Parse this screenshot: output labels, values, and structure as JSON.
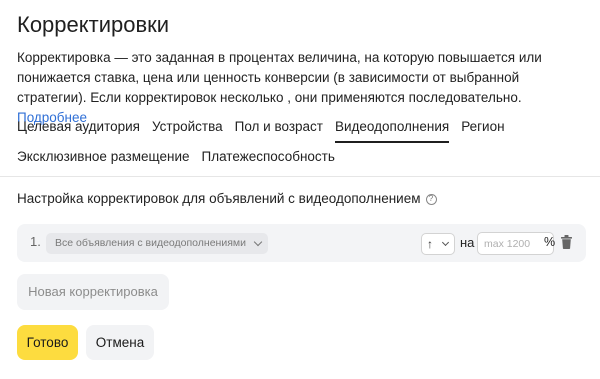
{
  "page": {
    "title": "Корректировки",
    "description": "Корректировка — это заданная в процентах величина, на которую повышается или понижается ставка, цена или ценность конверсии (в зависимости от выбранной стратегии). Если корректировок несколько , они применяются последовательно.",
    "more_link": "Подробнее"
  },
  "tabs": [
    {
      "label": "Целевая аудитория",
      "active": false
    },
    {
      "label": "Устройства",
      "active": false
    },
    {
      "label": "Пол и возраст",
      "active": false
    },
    {
      "label": "Видеодополнения",
      "active": true
    },
    {
      "label": "Регион",
      "active": false
    },
    {
      "label": "Эксклюзивное размещение",
      "active": false
    },
    {
      "label": "Платежеспособность",
      "active": false
    }
  ],
  "section": {
    "label": "Настройка корректировок для объявлений с видеодополнением",
    "help_icon": "help-icon"
  },
  "adjustment_row": {
    "number": "1.",
    "ad_filter": "Все объявления с видеодополнениями",
    "direction": "↑",
    "na_label": "на",
    "value": "",
    "value_placeholder": "max 1200",
    "unit": "%",
    "delete_icon": "trash-icon"
  },
  "buttons": {
    "new_adjustment": "Новая корректировка",
    "done": "Готово",
    "cancel": "Отмена"
  },
  "colors": {
    "link": "#2f6fd6",
    "primary_button": "#fddc3f",
    "secondary_button": "#f2f3f5",
    "row_background": "#f3f4f6"
  }
}
